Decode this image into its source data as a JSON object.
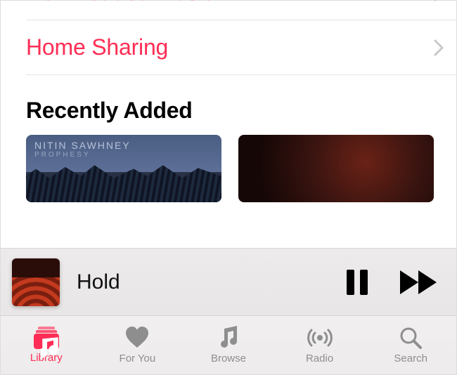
{
  "accent": "#ff2d55",
  "library_rows": [
    {
      "label": "Downloaded Music"
    },
    {
      "label": "Home Sharing"
    }
  ],
  "section_title": "Recently Added",
  "albums": [
    {
      "artist_line1": "NITIN SAWHNEY",
      "artist_line2": "PROPHESY"
    },
    {
      "artist_line1": "",
      "artist_line2": ""
    }
  ],
  "now_playing": {
    "title": "Hold"
  },
  "tabs": [
    {
      "label": "Library",
      "active": true
    },
    {
      "label": "For You",
      "active": false
    },
    {
      "label": "Browse",
      "active": false
    },
    {
      "label": "Radio",
      "active": false
    },
    {
      "label": "Search",
      "active": false
    }
  ]
}
